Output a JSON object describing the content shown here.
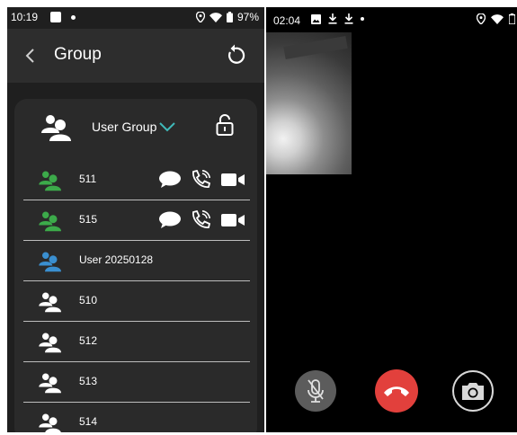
{
  "left_phone": {
    "status": {
      "time": "10:19",
      "battery": "97%"
    },
    "appbar": {
      "title": "Group"
    },
    "group": {
      "name": "User Group"
    },
    "members": [
      {
        "name": "511",
        "color": "#3caa4a",
        "actions": true
      },
      {
        "name": "515",
        "color": "#3caa4a",
        "actions": true
      },
      {
        "name": "User  20250128",
        "color": "#3a8fd0",
        "actions": false
      },
      {
        "name": "510",
        "color": "#ffffff",
        "actions": false
      },
      {
        "name": "512",
        "color": "#ffffff",
        "actions": false
      },
      {
        "name": "513",
        "color": "#ffffff",
        "actions": false
      },
      {
        "name": "514",
        "color": "#ffffff",
        "actions": false
      }
    ]
  },
  "right_phone": {
    "status": {
      "time": "02:04"
    }
  },
  "colors": {
    "accent_teal": "#3fb9b9",
    "online_green": "#3caa4a",
    "user_blue": "#3a8fd0",
    "hangup_red": "#e2403c"
  },
  "icons": [
    "back-icon",
    "refresh-icon",
    "group-icon",
    "chevron-down-icon",
    "lock-icon",
    "chat-icon",
    "voice-call-icon",
    "video-call-icon",
    "mic-off-icon",
    "hangup-icon",
    "camera-switch-icon"
  ]
}
